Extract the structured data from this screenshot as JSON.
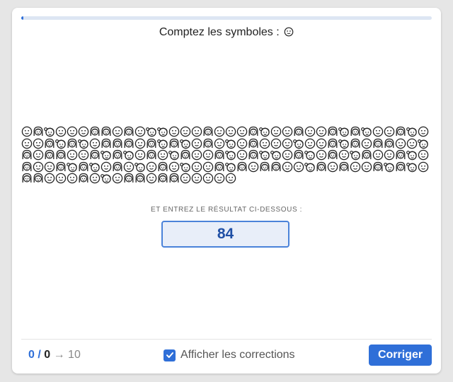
{
  "exercise": {
    "title": "Comptez les symboles :",
    "target_icon": "smiley-face-icon",
    "progress_fraction": 0.005,
    "symbols": {
      "total_shown": 163,
      "target_count": 84,
      "distractor_icons": [
        "woman-face-icon",
        "girl-face-icon"
      ],
      "sequence": [
        "s",
        "w",
        "g",
        "s",
        "s",
        "s",
        "w",
        "w",
        "s",
        "w",
        "s",
        "g",
        "g",
        "s",
        "s",
        "s",
        "w",
        "s",
        "s",
        "s",
        "w",
        "g",
        "s",
        "s",
        "w",
        "s",
        "s",
        "w",
        "g",
        "w",
        "g",
        "s",
        "s",
        "w",
        "g",
        "s",
        "s",
        "s",
        "w",
        "g",
        "w",
        "g",
        "s",
        "w",
        "w",
        "w",
        "s",
        "w",
        "g",
        "w",
        "g",
        "s",
        "w",
        "s",
        "g",
        "s",
        "w",
        "s",
        "s",
        "s",
        "g",
        "s",
        "s",
        "w",
        "g",
        "w",
        "s",
        "w",
        "w",
        "s",
        "s",
        "g",
        "w",
        "s",
        "w",
        "w",
        "s",
        "s",
        "w",
        "g",
        "w",
        "g",
        "s",
        "w",
        "s",
        "g",
        "w",
        "s",
        "s",
        "w",
        "g",
        "s",
        "w",
        "g",
        "g",
        "s",
        "w",
        "g",
        "s",
        "w",
        "s",
        "g",
        "w",
        "s",
        "s",
        "w",
        "g",
        "s",
        "w",
        "s",
        "s",
        "w",
        "g",
        "w",
        "g",
        "s",
        "w",
        "s",
        "g",
        "s",
        "w",
        "s",
        "g",
        "s",
        "s",
        "w",
        "g",
        "w",
        "s",
        "w",
        "w",
        "s",
        "s",
        "g",
        "w",
        "s",
        "w",
        "s",
        "s",
        "w",
        "g",
        "w",
        "g",
        "s",
        "w",
        "w",
        "s",
        "s",
        "s",
        "w",
        "s",
        "g",
        "s",
        "w",
        "w",
        "s",
        "w",
        "w",
        "s",
        "s",
        "s",
        "s",
        "s"
      ]
    },
    "instruction": "ET ENTREZ LE RÉSULTAT CI-DESSOUS :",
    "answer_value": "84"
  },
  "footer": {
    "score_current": "0",
    "score_separator": " / ",
    "score_total": "0",
    "score_arrow": " → ",
    "score_goal": "10",
    "show_corrections_label": "Afficher les corrections",
    "show_corrections_checked": true,
    "submit_label": "Corriger"
  },
  "colors": {
    "accent": "#2f6fd8",
    "input_bg": "#e8eef9",
    "input_border": "#4a82d9",
    "page_bg": "#e6e6e6"
  }
}
